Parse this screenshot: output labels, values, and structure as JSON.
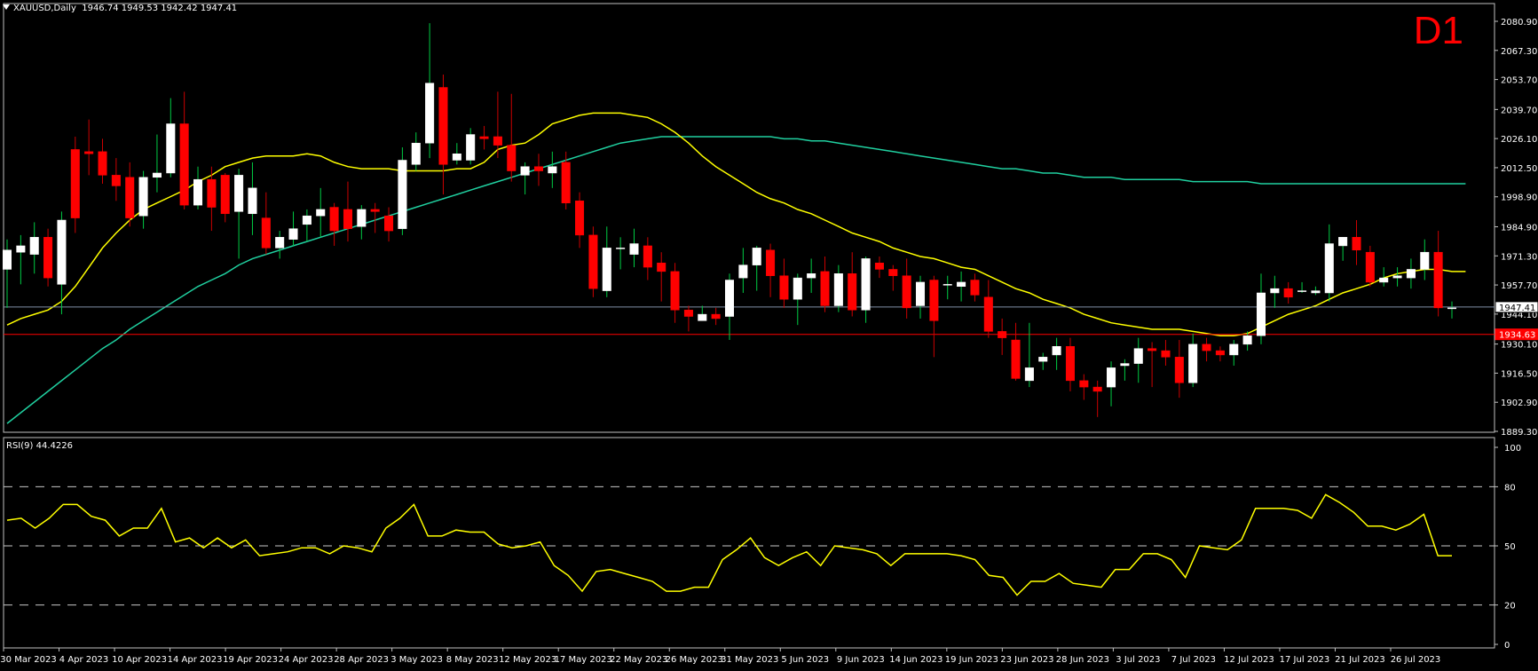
{
  "header": {
    "symbol": "XAUUSD,Daily",
    "ohlc": "1946.74 1949.53 1942.42 1947.41"
  },
  "timeframe_label": "D1",
  "rsi": {
    "label": "RSI(9) 44.4226"
  },
  "colors": {
    "background": "#000000",
    "bull": "#ffffff",
    "bear": "#ff0000",
    "ma_fast": "#ffff00",
    "ma_slow": "#20d0a0",
    "rsi_line": "#ffff00",
    "bid_line": "#7f8fa6",
    "level_line": "#ff0000"
  },
  "chart_data": [
    {
      "type": "candlestick",
      "symbol": "XAUUSD",
      "timeframe": "Daily",
      "ylim": [
        1889.3,
        2080.9
      ],
      "y_ticks": [
        "2080.90",
        "2067.30",
        "2053.70",
        "2039.70",
        "2026.10",
        "2012.50",
        "1998.90",
        "1984.90",
        "1971.30",
        "1957.70",
        "1944.10",
        "1930.10",
        "1916.50",
        "1902.90",
        "1889.30"
      ],
      "current_price": "1947.41",
      "level_price": "1934.63",
      "x_tick_labels": [
        "30 Mar 2023",
        "4 Apr 2023",
        "10 Apr 2023",
        "14 Apr 2023",
        "19 Apr 2023",
        "24 Apr 2023",
        "28 Apr 2023",
        "3 May 2023",
        "8 May 2023",
        "12 May 2023",
        "17 May 2023",
        "22 May 2023",
        "26 May 2023",
        "31 May 2023",
        "5 Jun 2023",
        "9 Jun 2023",
        "14 Jun 2023",
        "19 Jun 2023",
        "23 Jun 2023",
        "28 Jun 2023",
        "3 Jul 2023",
        "7 Jul 2023",
        "12 Jul 2023",
        "17 Jul 2023",
        "21 Jul 2023",
        "26 Jul 2023"
      ],
      "candles": [
        [
          1965,
          1974,
          1947,
          1979
        ],
        [
          1973,
          1976,
          1958,
          1981
        ],
        [
          1972,
          1980,
          1963,
          1987
        ],
        [
          1980,
          1961,
          1957,
          1984
        ],
        [
          1958,
          1988,
          1944,
          1992
        ],
        [
          2021,
          1989,
          1982,
          2027
        ],
        [
          2020,
          2019,
          2009,
          2035
        ],
        [
          2020,
          2009,
          2005,
          2026
        ],
        [
          2009,
          2004,
          1997,
          2017
        ],
        [
          2008,
          1989,
          1985,
          2015
        ],
        [
          1990,
          2008,
          1984,
          2011
        ],
        [
          2008,
          2010,
          2001,
          2028
        ],
        [
          2010,
          2033,
          2008,
          2045
        ],
        [
          2033,
          1995,
          1993,
          2048
        ],
        [
          1995,
          2007,
          1993,
          2013
        ],
        [
          2007,
          1994,
          1983,
          2013
        ],
        [
          2009,
          1991,
          1987,
          2010
        ],
        [
          1992,
          2009,
          1970,
          2012
        ],
        [
          1991,
          2003,
          1981,
          2015
        ],
        [
          1989,
          1975,
          1972,
          2001
        ],
        [
          1975,
          1980,
          1970,
          1983
        ],
        [
          1979,
          1984,
          1976,
          1992
        ],
        [
          1986,
          1990,
          1978,
          1993
        ],
        [
          1990,
          1993,
          1980,
          2003
        ],
        [
          1994,
          1983,
          1976,
          1996
        ],
        [
          1993,
          1984,
          1978,
          2006
        ],
        [
          1985,
          1993,
          1979,
          1995
        ],
        [
          1993,
          1992,
          1982,
          1996
        ],
        [
          1990,
          1983,
          1978,
          1994
        ],
        [
          1984,
          2016,
          1981,
          2022
        ],
        [
          2014,
          2024,
          2011,
          2029
        ],
        [
          2024,
          2052,
          2017,
          2080
        ],
        [
          2050,
          2014,
          2000,
          2056
        ],
        [
          2016,
          2019,
          2014,
          2024
        ],
        [
          2016,
          2028,
          2014,
          2031
        ],
        [
          2027,
          2026,
          2021,
          2032
        ],
        [
          2027,
          2023,
          2017,
          2048
        ],
        [
          2023,
          2011,
          2006,
          2047
        ],
        [
          2009,
          2013,
          2000,
          2015
        ],
        [
          2013,
          2011,
          2004,
          2019
        ],
        [
          2010,
          2013,
          2003,
          2020
        ],
        [
          2015,
          1996,
          1993,
          2020
        ],
        [
          1997,
          1981,
          1975,
          2001
        ],
        [
          1981,
          1956,
          1952,
          1985
        ],
        [
          1955,
          1975,
          1952,
          1985
        ],
        [
          1975,
          1975,
          1965,
          1980
        ],
        [
          1972,
          1977,
          1966,
          1984
        ],
        [
          1976,
          1966,
          1960,
          1980
        ],
        [
          1968,
          1964,
          1950,
          1973
        ],
        [
          1964,
          1946,
          1940,
          1968
        ],
        [
          1946,
          1943,
          1936,
          1948
        ],
        [
          1941,
          1944,
          1941,
          1948
        ],
        [
          1944,
          1942,
          1939,
          1947
        ],
        [
          1943,
          1960,
          1932,
          1963
        ],
        [
          1961,
          1967,
          1954,
          1975
        ],
        [
          1967,
          1975,
          1955,
          1976
        ],
        [
          1974,
          1962,
          1952,
          1977
        ],
        [
          1962,
          1951,
          1947,
          1970
        ],
        [
          1951,
          1961,
          1939,
          1963
        ],
        [
          1961,
          1963,
          1954,
          1970
        ],
        [
          1964,
          1948,
          1945,
          1971
        ],
        [
          1948,
          1963,
          1945,
          1967
        ],
        [
          1963,
          1946,
          1943,
          1973
        ],
        [
          1946,
          1970,
          1940,
          1971
        ],
        [
          1968,
          1965,
          1961,
          1971
        ],
        [
          1965,
          1962,
          1955,
          1967
        ],
        [
          1962,
          1947,
          1942,
          1970
        ],
        [
          1948,
          1959,
          1942,
          1962
        ],
        [
          1960,
          1941,
          1924,
          1962
        ],
        [
          1958,
          1958,
          1951,
          1962
        ],
        [
          1957,
          1959,
          1950,
          1964
        ],
        [
          1960,
          1953,
          1950,
          1963
        ],
        [
          1952,
          1936,
          1933,
          1960
        ],
        [
          1936,
          1933,
          1925,
          1942
        ],
        [
          1932,
          1914,
          1913,
          1940
        ],
        [
          1913,
          1919,
          1910,
          1940
        ],
        [
          1922,
          1924,
          1918,
          1926
        ],
        [
          1925,
          1929,
          1918,
          1933
        ],
        [
          1929,
          1913,
          1908,
          1933
        ],
        [
          1913,
          1910,
          1904,
          1916
        ],
        [
          1910,
          1908,
          1896,
          1913
        ],
        [
          1910,
          1919,
          1901,
          1922
        ],
        [
          1920,
          1921,
          1913,
          1923
        ],
        [
          1921,
          1928,
          1912,
          1933
        ],
        [
          1928,
          1927,
          1910,
          1931
        ],
        [
          1927,
          1924,
          1920,
          1932
        ],
        [
          1924,
          1912,
          1905,
          1932
        ],
        [
          1912,
          1930,
          1910,
          1935
        ],
        [
          1930,
          1927,
          1922,
          1933
        ],
        [
          1927,
          1925,
          1922,
          1929
        ],
        [
          1925,
          1930,
          1920,
          1932
        ],
        [
          1930,
          1934,
          1927,
          1936
        ],
        [
          1934,
          1954,
          1930,
          1963
        ],
        [
          1954,
          1956,
          1947,
          1962
        ],
        [
          1956,
          1952,
          1949,
          1959
        ],
        [
          1955,
          1955,
          1954,
          1959
        ],
        [
          1954,
          1955,
          1953,
          1957
        ],
        [
          1954,
          1977,
          1950,
          1986
        ],
        [
          1976,
          1980,
          1969,
          1980
        ],
        [
          1980,
          1974,
          1967,
          1988
        ],
        [
          1973,
          1959,
          1957,
          1976
        ],
        [
          1959,
          1961,
          1957,
          1966
        ],
        [
          1961,
          1962,
          1957,
          1966
        ],
        [
          1961,
          1965,
          1956,
          1970
        ],
        [
          1965,
          1973,
          1960,
          1979
        ],
        [
          1973,
          1947,
          1943,
          1983
        ],
        [
          1947,
          1947,
          1942,
          1950
        ]
      ],
      "ma_fast": [
        1939,
        1942,
        1944,
        1946,
        1950,
        1957,
        1966,
        1975,
        1982,
        1988,
        1993,
        1996,
        1999,
        2002,
        2006,
        2009,
        2013,
        2015,
        2017,
        2018,
        2018,
        2018,
        2019,
        2018,
        2015,
        2013,
        2012,
        2012,
        2012,
        2011,
        2011,
        2011,
        2011,
        2012,
        2012,
        2015,
        2021,
        2023,
        2024,
        2028,
        2033,
        2035,
        2037,
        2038,
        2038,
        2038,
        2037,
        2036,
        2033,
        2029,
        2024,
        2018,
        2013,
        2009,
        2005,
        2001,
        1998,
        1996,
        1993,
        1991,
        1988,
        1985,
        1982,
        1980,
        1978,
        1975,
        1973,
        1971,
        1970,
        1968,
        1966,
        1965,
        1962,
        1959,
        1956,
        1954,
        1951,
        1949,
        1947,
        1944,
        1942,
        1940,
        1939,
        1938,
        1937,
        1937,
        1937,
        1936,
        1935,
        1934,
        1934,
        1935,
        1938,
        1941,
        1944,
        1946,
        1948,
        1951,
        1954,
        1956,
        1958,
        1961,
        1963,
        1964,
        1965,
        1965,
        1964,
        1964
      ],
      "ma_slow": [
        1893,
        1898,
        1903,
        1908,
        1913,
        1918,
        1923,
        1928,
        1932,
        1937,
        1941,
        1945,
        1949,
        1953,
        1957,
        1960,
        1963,
        1967,
        1970,
        1972,
        1974,
        1976,
        1978,
        1980,
        1982,
        1984,
        1986,
        1988,
        1990,
        1992,
        1994,
        1996,
        1998,
        2000,
        2002,
        2004,
        2006,
        2008,
        2010,
        2012,
        2014,
        2016,
        2018,
        2020,
        2022,
        2024,
        2025,
        2026,
        2027,
        2027,
        2027,
        2027,
        2027,
        2027,
        2027,
        2027,
        2027,
        2026,
        2026,
        2025,
        2025,
        2024,
        2023,
        2022,
        2021,
        2020,
        2019,
        2018,
        2017,
        2016,
        2015,
        2014,
        2013,
        2012,
        2012,
        2011,
        2010,
        2010,
        2009,
        2008,
        2008,
        2008,
        2007,
        2007,
        2007,
        2007,
        2007,
        2006,
        2006,
        2006,
        2006,
        2006,
        2005,
        2005,
        2005,
        2005,
        2005,
        2005,
        2005,
        2005,
        2005,
        2005,
        2005,
        2005,
        2005,
        2005,
        2005,
        2005
      ],
      "ma_fast_periods": 20,
      "ma_slow_periods": 50
    },
    {
      "type": "line",
      "name": "RSI(9)",
      "ylim": [
        0,
        100
      ],
      "y_ticks": [
        "100",
        "80",
        "50",
        "20",
        "0"
      ],
      "levels": [
        80,
        50,
        20
      ],
      "values": [
        63,
        64,
        59,
        64,
        71,
        71,
        65,
        63,
        55,
        59,
        59,
        69,
        52,
        54,
        49,
        54,
        49,
        53,
        45,
        46,
        47,
        49,
        49,
        46,
        50,
        49,
        47,
        59,
        64,
        71,
        55,
        55,
        58,
        57,
        57,
        51,
        49,
        50,
        52,
        40,
        35,
        27,
        37,
        38,
        36,
        34,
        32,
        27,
        27,
        29,
        29,
        43,
        48,
        54,
        44,
        40,
        44,
        47,
        40,
        50,
        49,
        48,
        46,
        40,
        46,
        46,
        46,
        46,
        45,
        43,
        35,
        34,
        25,
        32,
        32,
        36,
        31,
        30,
        29,
        38,
        38,
        46,
        46,
        43,
        34,
        50,
        49,
        48,
        53,
        69,
        69,
        69,
        68,
        64,
        76,
        72,
        67,
        60,
        60,
        58,
        61,
        66,
        45,
        45
      ]
    }
  ]
}
